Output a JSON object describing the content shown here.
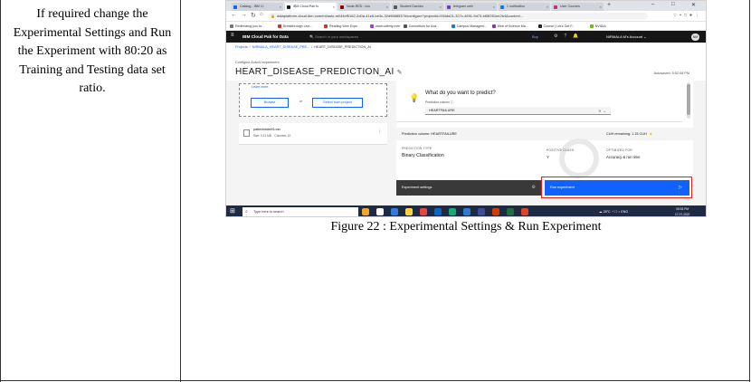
{
  "document": {
    "instruction": "If required change the Experimental Settings and Run the Experiment with 80:20 as Training and Testing data set ratio.",
    "caption": "Figure 22 : Experimental Settings & Run Experiment"
  },
  "browser": {
    "tabs": [
      {
        "label": "Catalog - IBM Cl",
        "color": "#0f62fe",
        "active": false
      },
      {
        "label": "IBM Cloud Pak fo",
        "color": "#161616",
        "active": true
      },
      {
        "label": "Node-RED : ncu",
        "color": "#8f0000",
        "active": false
      },
      {
        "label": "Student Dashbo",
        "color": "#555555",
        "active": false
      },
      {
        "label": "telegram web",
        "color": "#6a3cc9",
        "active": false
      },
      {
        "label": "1 notification",
        "color": "#1a73e8",
        "active": false
      },
      {
        "label": "User Courses",
        "color": "#d12771",
        "active": false
      }
    ],
    "url": "dataplatform.cloud.ibm.com/ml/auto-ml/44ef5162-2d0a-41e6-be3c-32d9688537b/configure?projectid=934dd21-327c-4691-9d73-b65f251ee2b4&context...",
    "bookmarks": [
      {
        "label": "Redirecting you to...",
        "color": "#777777"
      },
      {
        "label": "Breakthrough Live...",
        "color": "#d93025"
      },
      {
        "label": "Reading Wire Expe...",
        "color": "#d93025"
      },
      {
        "label": "www.udemy.com",
        "color": "#a435f0"
      },
      {
        "label": "Consortium for Aca...",
        "color": "#555555"
      },
      {
        "label": "Campus Managem...",
        "color": "#1a73e8"
      },
      {
        "label": "Web of Science Ma...",
        "color": "#7b3fa0"
      },
      {
        "label": "Course | Let's Get F...",
        "color": "#222222"
      },
      {
        "label": "NVIDIA",
        "color": "#76b900"
      }
    ]
  },
  "app": {
    "brand": "IBM Cloud Pak for Data",
    "search_placeholder": "Search in your workspaces",
    "buy": "Buy",
    "account": "NIRMALA M's Account",
    "avatar": "NM",
    "breadcrumb": {
      "projects": "Projects",
      "project": "NIRMALA_HEART_DISEASE_PRE...",
      "current": "HEART_DISEASE_PREDICTION_AI"
    },
    "configure_label": "Configure AutoAI experiment",
    "experiment_title": "HEART_DISEASE_PREDICTION_AI",
    "autosaved": "Autosaved: 5:52:08 PM"
  },
  "data_source": {
    "learn_more": "Learn more.",
    "browse": "Browse",
    "or": "or",
    "select_from_project": "Select from project",
    "file_name": "patientdataV6.csv",
    "file_size": "Size: 0.21 MB",
    "file_columns": "Columns: 10"
  },
  "prediction": {
    "question": "What do you want to predict?",
    "column_label": "Prediction column",
    "selected_column": "HEARTFAILURE",
    "column_summary": "Prediction column: HEARTFAILURE",
    "cuh_remaining": "CUH remaining:  1.15 CUH",
    "type_label": "Prediction type",
    "type_value": "Binary Classification",
    "positive_class_label": "Positive class",
    "positive_class_value": "Y",
    "optimized_label": "Optimized for",
    "optimized_value": "Accuracy & run time",
    "settings_button": "Experiment settings",
    "run_button": "Run experiment"
  },
  "taskbar": {
    "search_placeholder": "Type here to search",
    "apps": [
      "#f4a52a",
      "#ffffff",
      "#2f7de1",
      "#ffd43b",
      "#e8453c",
      "#0a66c2",
      "#19a974",
      "#2b7cd3",
      "#3e4d9a",
      "#d83b01",
      "#1d6f42",
      "#e24329"
    ],
    "weather": "28°C",
    "lang": "ENG",
    "time": "05:53 PM",
    "date": "17-07-2022"
  },
  "colors": {
    "ibm_blue": "#0f62fe",
    "highlight_red": "#e0201a",
    "ibm_black": "#161616"
  }
}
